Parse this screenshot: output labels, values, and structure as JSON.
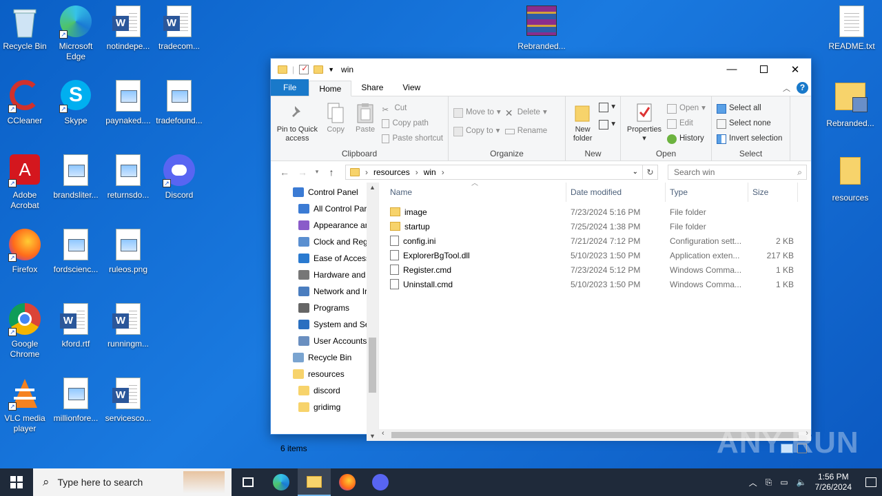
{
  "desktop": {
    "icons": [
      {
        "label": "Recycle Bin",
        "type": "recycle"
      },
      {
        "label": "Microsoft Edge",
        "type": "edge"
      },
      {
        "label": "notindepe...",
        "type": "word"
      },
      {
        "label": "tradecom...",
        "type": "word"
      },
      {
        "label": "CCleaner",
        "type": "ccleaner"
      },
      {
        "label": "Skype",
        "type": "skype"
      },
      {
        "label": "paynaked....",
        "type": "image"
      },
      {
        "label": "tradefound...",
        "type": "image"
      },
      {
        "label": "Adobe Acrobat",
        "type": "acrobat"
      },
      {
        "label": "brandsliter...",
        "type": "image"
      },
      {
        "label": "returnsdo...",
        "type": "image"
      },
      {
        "label": "Discord",
        "type": "discord"
      },
      {
        "label": "Firefox",
        "type": "firefox"
      },
      {
        "label": "fordscienc...",
        "type": "image"
      },
      {
        "label": "ruleos.png",
        "type": "image"
      },
      {
        "label": "Google Chrome",
        "type": "chrome"
      },
      {
        "label": "kford.rtf",
        "type": "word"
      },
      {
        "label": "runningm...",
        "type": "word"
      },
      {
        "label": "VLC media player",
        "type": "vlc"
      },
      {
        "label": "millionfore...",
        "type": "image"
      },
      {
        "label": "servicesco...",
        "type": "word"
      },
      {
        "label": "Rebranded...",
        "type": "winrar"
      },
      {
        "label": "README.txt",
        "type": "text"
      },
      {
        "label": "Rebranded...",
        "type": "folder-special"
      },
      {
        "label": "resources",
        "type": "folder"
      }
    ]
  },
  "explorer": {
    "title": "win",
    "tabs": [
      "File",
      "Home",
      "Share",
      "View"
    ],
    "active_tab": "Home",
    "ribbon": {
      "clipboard": {
        "label": "Clipboard",
        "pin": "Pin to Quick access",
        "copy": "Copy",
        "paste": "Paste",
        "cut": "Cut",
        "copy_path": "Copy path",
        "paste_shortcut": "Paste shortcut"
      },
      "organize": {
        "label": "Organize",
        "move_to": "Move to",
        "copy_to": "Copy to",
        "delete": "Delete",
        "rename": "Rename"
      },
      "new": {
        "label": "New",
        "new_folder": "New folder"
      },
      "open": {
        "label": "Open",
        "properties": "Properties",
        "open": "Open",
        "edit": "Edit",
        "history": "History"
      },
      "select": {
        "label": "Select",
        "select_all": "Select all",
        "select_none": "Select none",
        "invert": "Invert selection"
      }
    },
    "address": {
      "crumbs": [
        "resources",
        "win"
      ],
      "search_placeholder": "Search win"
    },
    "nav": [
      {
        "label": "Control Panel",
        "indent": 0
      },
      {
        "label": "All Control Par",
        "indent": 1
      },
      {
        "label": "Appearance an",
        "indent": 1
      },
      {
        "label": "Clock and Regi",
        "indent": 1
      },
      {
        "label": "Ease of Access",
        "indent": 1
      },
      {
        "label": "Hardware and",
        "indent": 1
      },
      {
        "label": "Network and Ir",
        "indent": 1
      },
      {
        "label": "Programs",
        "indent": 1
      },
      {
        "label": "System and Se",
        "indent": 1
      },
      {
        "label": "User Accounts",
        "indent": 1
      },
      {
        "label": "Recycle Bin",
        "indent": 0
      },
      {
        "label": "resources",
        "indent": 0
      },
      {
        "label": "discord",
        "indent": 1
      },
      {
        "label": "gridimg",
        "indent": 1
      }
    ],
    "columns": [
      "Name",
      "Date modified",
      "Type",
      "Size"
    ],
    "files": [
      {
        "name": "image",
        "date": "7/23/2024 5:16 PM",
        "type": "File folder",
        "size": "",
        "icon": "folder"
      },
      {
        "name": "startup",
        "date": "7/25/2024 1:38 PM",
        "type": "File folder",
        "size": "",
        "icon": "folder"
      },
      {
        "name": "config.ini",
        "date": "7/21/2024 7:12 PM",
        "type": "Configuration sett...",
        "size": "2 KB",
        "icon": "ini"
      },
      {
        "name": "ExplorerBgTool.dll",
        "date": "5/10/2023 1:50 PM",
        "type": "Application exten...",
        "size": "217 KB",
        "icon": "dll"
      },
      {
        "name": "Register.cmd",
        "date": "7/23/2024 5:12 PM",
        "type": "Windows Comma...",
        "size": "1 KB",
        "icon": "cmd"
      },
      {
        "name": "Uninstall.cmd",
        "date": "5/10/2023 1:50 PM",
        "type": "Windows Comma...",
        "size": "1 KB",
        "icon": "cmd"
      }
    ],
    "status": "6 items"
  },
  "taskbar": {
    "search_placeholder": "Type here to search",
    "time": "1:56 PM",
    "date": "7/26/2024"
  },
  "watermark": "ANY RUN"
}
